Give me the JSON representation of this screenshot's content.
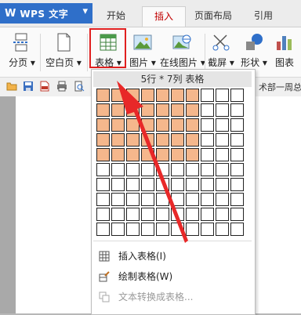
{
  "app": {
    "title": "WPS 文字",
    "logo": "W"
  },
  "tabs": [
    {
      "label": "开始",
      "active": false
    },
    {
      "label": "插入",
      "active": true
    },
    {
      "label": "页面布局",
      "active": false
    },
    {
      "label": "引用",
      "active": false
    }
  ],
  "ribbon": {
    "page_break": "分页",
    "blank_page": "空白页",
    "table": "表格",
    "picture": "图片",
    "online_picture": "在线图片",
    "screenshot": "截屏",
    "shapes": "形状",
    "chart": "图表"
  },
  "quickbar": {
    "doc_title": "术部一周总结"
  },
  "dropdown": {
    "grid_label": "5行 * 7列 表格",
    "grid": {
      "rows": 10,
      "cols": 10,
      "selected_rows": 5,
      "selected_cols": 7
    },
    "insert_table": "插入表格(I)",
    "draw_table": "绘制表格(W)",
    "text_to_table": "文本转换成表格..."
  },
  "colors": {
    "accent": "#2f6fc9",
    "highlight": "#e02020",
    "cell_selected": "#f5b78c"
  }
}
